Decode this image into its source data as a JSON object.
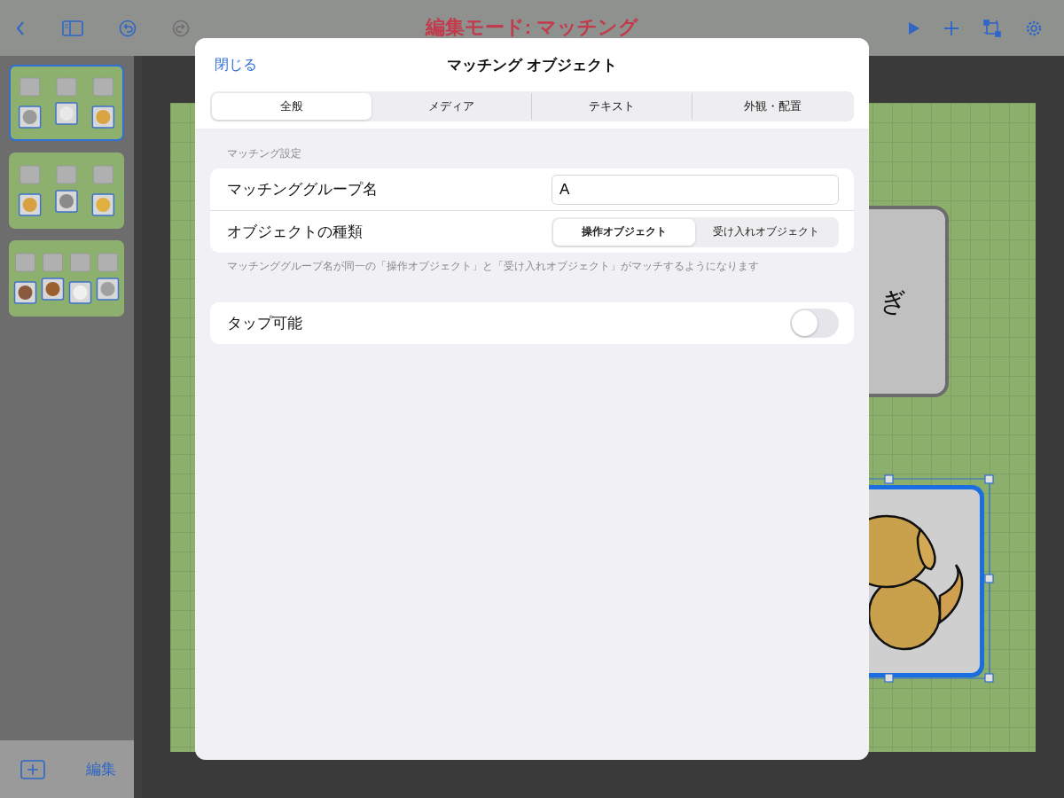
{
  "toolbar": {
    "title": "編集モード: マッチング",
    "redo_disabled": true
  },
  "slides": [
    {
      "selected": true
    },
    {
      "selected": false
    },
    {
      "selected": false
    }
  ],
  "sidebar_footer": {
    "edit_label": "編集"
  },
  "canvas": {
    "card_text": "ぎ"
  },
  "dialog": {
    "close": "閉じる",
    "title": "マッチング オブジェクト",
    "tabs": [
      {
        "label": "全般",
        "selected": true
      },
      {
        "label": "メディア",
        "selected": false
      },
      {
        "label": "テキスト",
        "selected": false
      },
      {
        "label": "外観・配置",
        "selected": false
      }
    ],
    "section_header": "マッチング設定",
    "fields": [
      {
        "kind": "text",
        "label": "マッチンググループ名",
        "value": "A"
      },
      {
        "kind": "segmented",
        "label": "オブジェクトの種類",
        "options": [
          {
            "label": "操作オブジェクト",
            "selected": true
          },
          {
            "label": "受け入れオブジェクト",
            "selected": false
          }
        ]
      }
    ],
    "footnote": "マッチンググループ名が同一の「操作オブジェクト」と「受け入れオブジェクト」がマッチするようになります",
    "toggles": [
      {
        "label": "タップ可能",
        "on": false
      }
    ]
  }
}
